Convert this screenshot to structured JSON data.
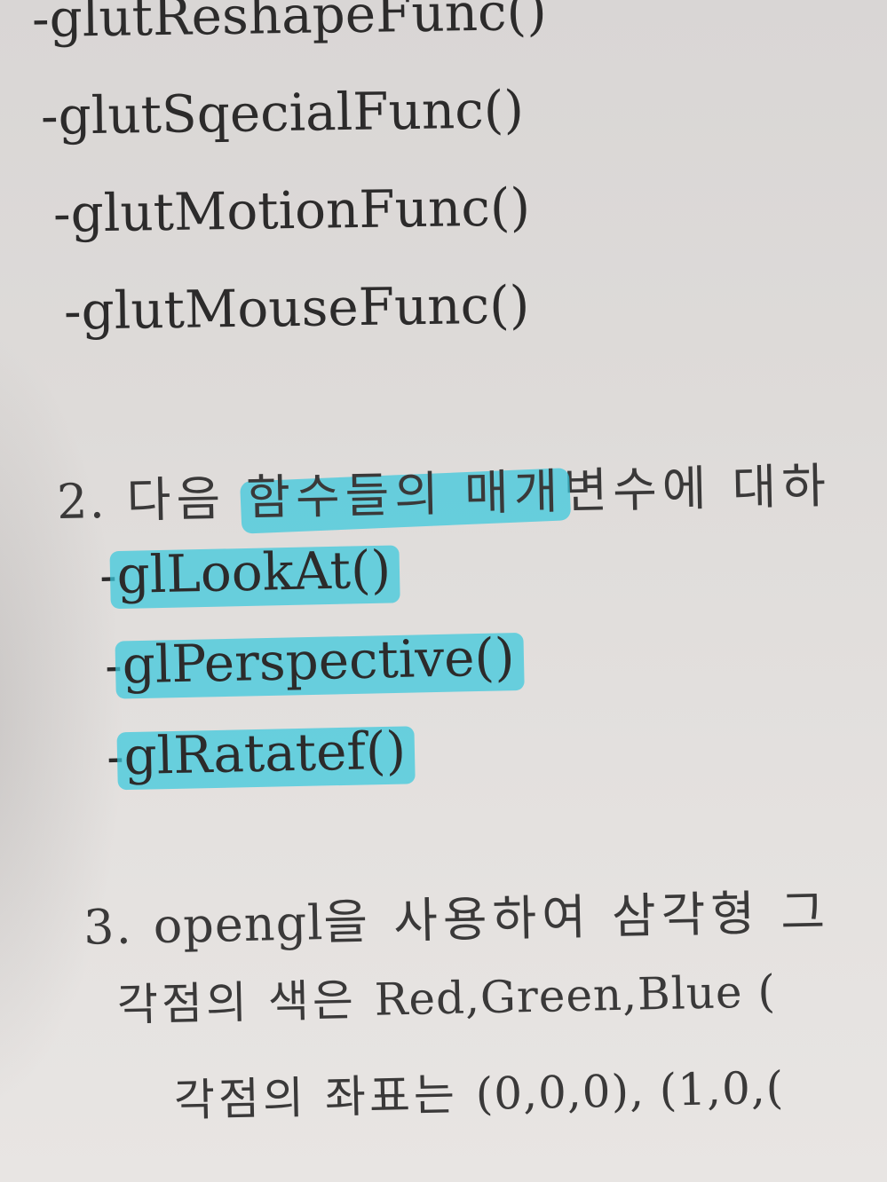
{
  "section1": {
    "items": [
      "-glutReshapeFunc()",
      "-glutSqecialFunc()",
      "-glutMotionFunc()",
      "-glutMouseFunc()"
    ]
  },
  "section2": {
    "number": "2.",
    "heading_pre": "다음 ",
    "heading_highlight": "함수들의 매개",
    "heading_post": "변수에 대하",
    "dash": "-",
    "items": [
      "glLookAt()",
      "glPerspective()",
      "glRatatef()"
    ]
  },
  "section3": {
    "number": "3.",
    "heading_latin": "opengl",
    "heading_rest": "을 사용하여 삼각형 그",
    "line2_korean": "각점의 색은 ",
    "line2_latin": "Red,Green,Blue (",
    "line3_korean": "각점의 좌표는 ",
    "line3_latin": "(0,0,0), (1,0,("
  }
}
